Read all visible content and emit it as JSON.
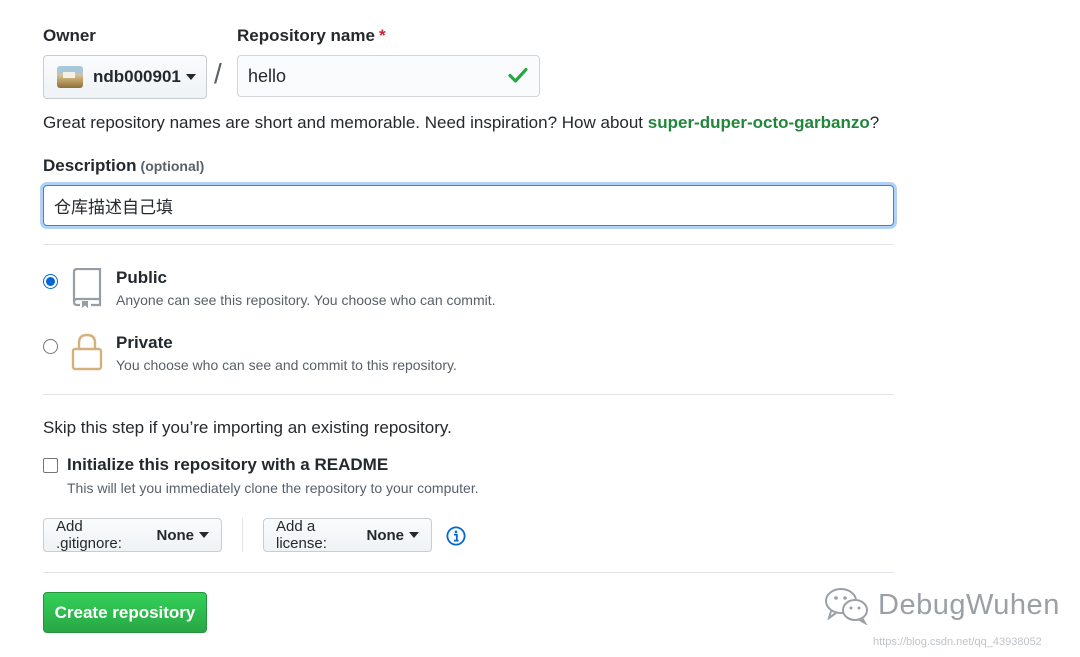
{
  "owner": {
    "label": "Owner",
    "selected": "ndb000901"
  },
  "repo_name": {
    "label": "Repository name",
    "required_mark": "*",
    "value": "hello",
    "separator": "/"
  },
  "hint": {
    "text": "Great repository names are short and memorable. Need inspiration? How about ",
    "suggestion": "super-duper-octo-garbanzo",
    "end": "?"
  },
  "description": {
    "label": "Description",
    "optional": "(optional)",
    "value": "仓库描述自己填"
  },
  "visibility": {
    "public": {
      "title": "Public",
      "desc": "Anyone can see this repository. You choose who can commit.",
      "icon": "repo-icon",
      "checked": true
    },
    "private": {
      "title": "Private",
      "desc": "You choose who can see and commit to this repository.",
      "icon": "lock-icon",
      "checked": false
    }
  },
  "init": {
    "skip_text": "Skip this step if you’re importing an existing repository.",
    "readme_label": "Initialize this repository with a README",
    "readme_desc": "This will let you immediately clone the repository to your computer.",
    "readme_checked": false
  },
  "gitignore": {
    "label": "Add .gitignore:",
    "value": "None"
  },
  "license": {
    "label": "Add a license:",
    "value": "None"
  },
  "create_button": "Create repository",
  "watermark": {
    "brand": "DebugWuhen",
    "url": "https://blog.csdn.net/qq_43938052"
  },
  "colors": {
    "accent_blue": "#0366d6",
    "success_green": "#28a745",
    "suggestion_green": "#22863a",
    "required_red": "#cb2431"
  }
}
